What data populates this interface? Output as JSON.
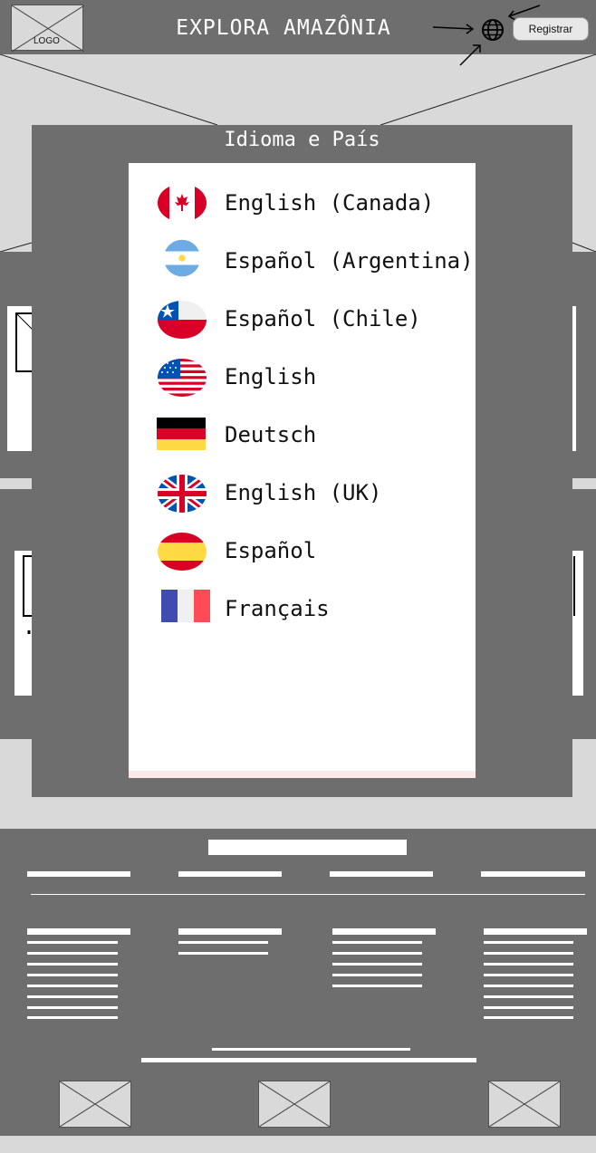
{
  "header": {
    "logo_text": "LOGO",
    "title": "EXPLORA AMAZÔNIA",
    "globe_icon": "globe-icon",
    "register_label": "Registrar"
  },
  "modal": {
    "title": "Idioma e País",
    "languages": [
      {
        "label": "English (Canada)",
        "flag": "canada-flag-icon"
      },
      {
        "label": "Español (Argentina)",
        "flag": "argentina-flag-icon"
      },
      {
        "label": "Español (Chile)",
        "flag": "chile-flag-icon"
      },
      {
        "label": "English",
        "flag": "usa-flag-icon"
      },
      {
        "label": "Deutsch",
        "flag": "germany-flag-icon"
      },
      {
        "label": "English (UK)",
        "flag": "uk-flag-icon"
      },
      {
        "label": "Español",
        "flag": "spain-flag-icon"
      },
      {
        "label": "Français",
        "flag": "france-flag-icon"
      }
    ]
  },
  "colors": {
    "dark_gray": "#6f6e6e",
    "light_gray": "#d9d9d9",
    "white": "#ffffff"
  }
}
